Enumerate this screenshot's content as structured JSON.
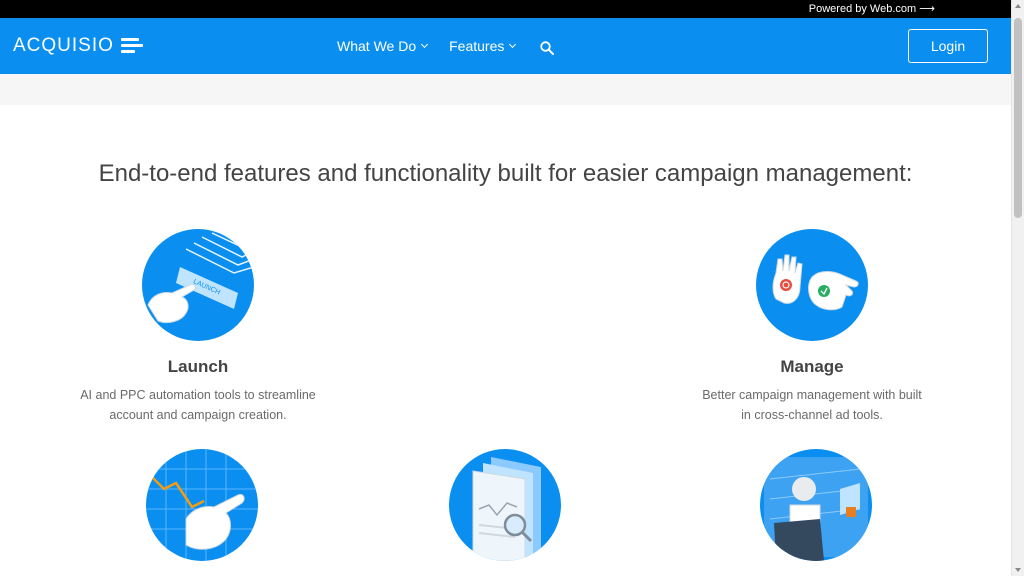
{
  "topbar": {
    "powered_by": "Powered by Web.com ⟶"
  },
  "nav": {
    "logo_text": "ACQUISIO",
    "menu": [
      {
        "label": "What We Do"
      },
      {
        "label": "Features"
      }
    ],
    "login_label": "Login"
  },
  "main": {
    "headline": "End-to-end features and functionality built for easier campaign management:",
    "features": [
      {
        "title": "Launch",
        "description_line1": "AI and PPC automation tools to streamline",
        "description_line2": "account and campaign creation."
      },
      {
        "title": "Manage",
        "description_line1": "Better campaign management with built",
        "description_line2": "in cross-channel ad tools."
      }
    ],
    "launch_badge": "LAUNCH"
  },
  "colors": {
    "brand_blue": "#0a8ff0",
    "topbar": "#000000"
  },
  "icons": [
    "search-icon",
    "chevron-down-icon",
    "launch-illustration-icon",
    "manage-illustration-icon",
    "optimize-illustration-icon",
    "report-illustration-icon",
    "bid-illustration-icon"
  ]
}
